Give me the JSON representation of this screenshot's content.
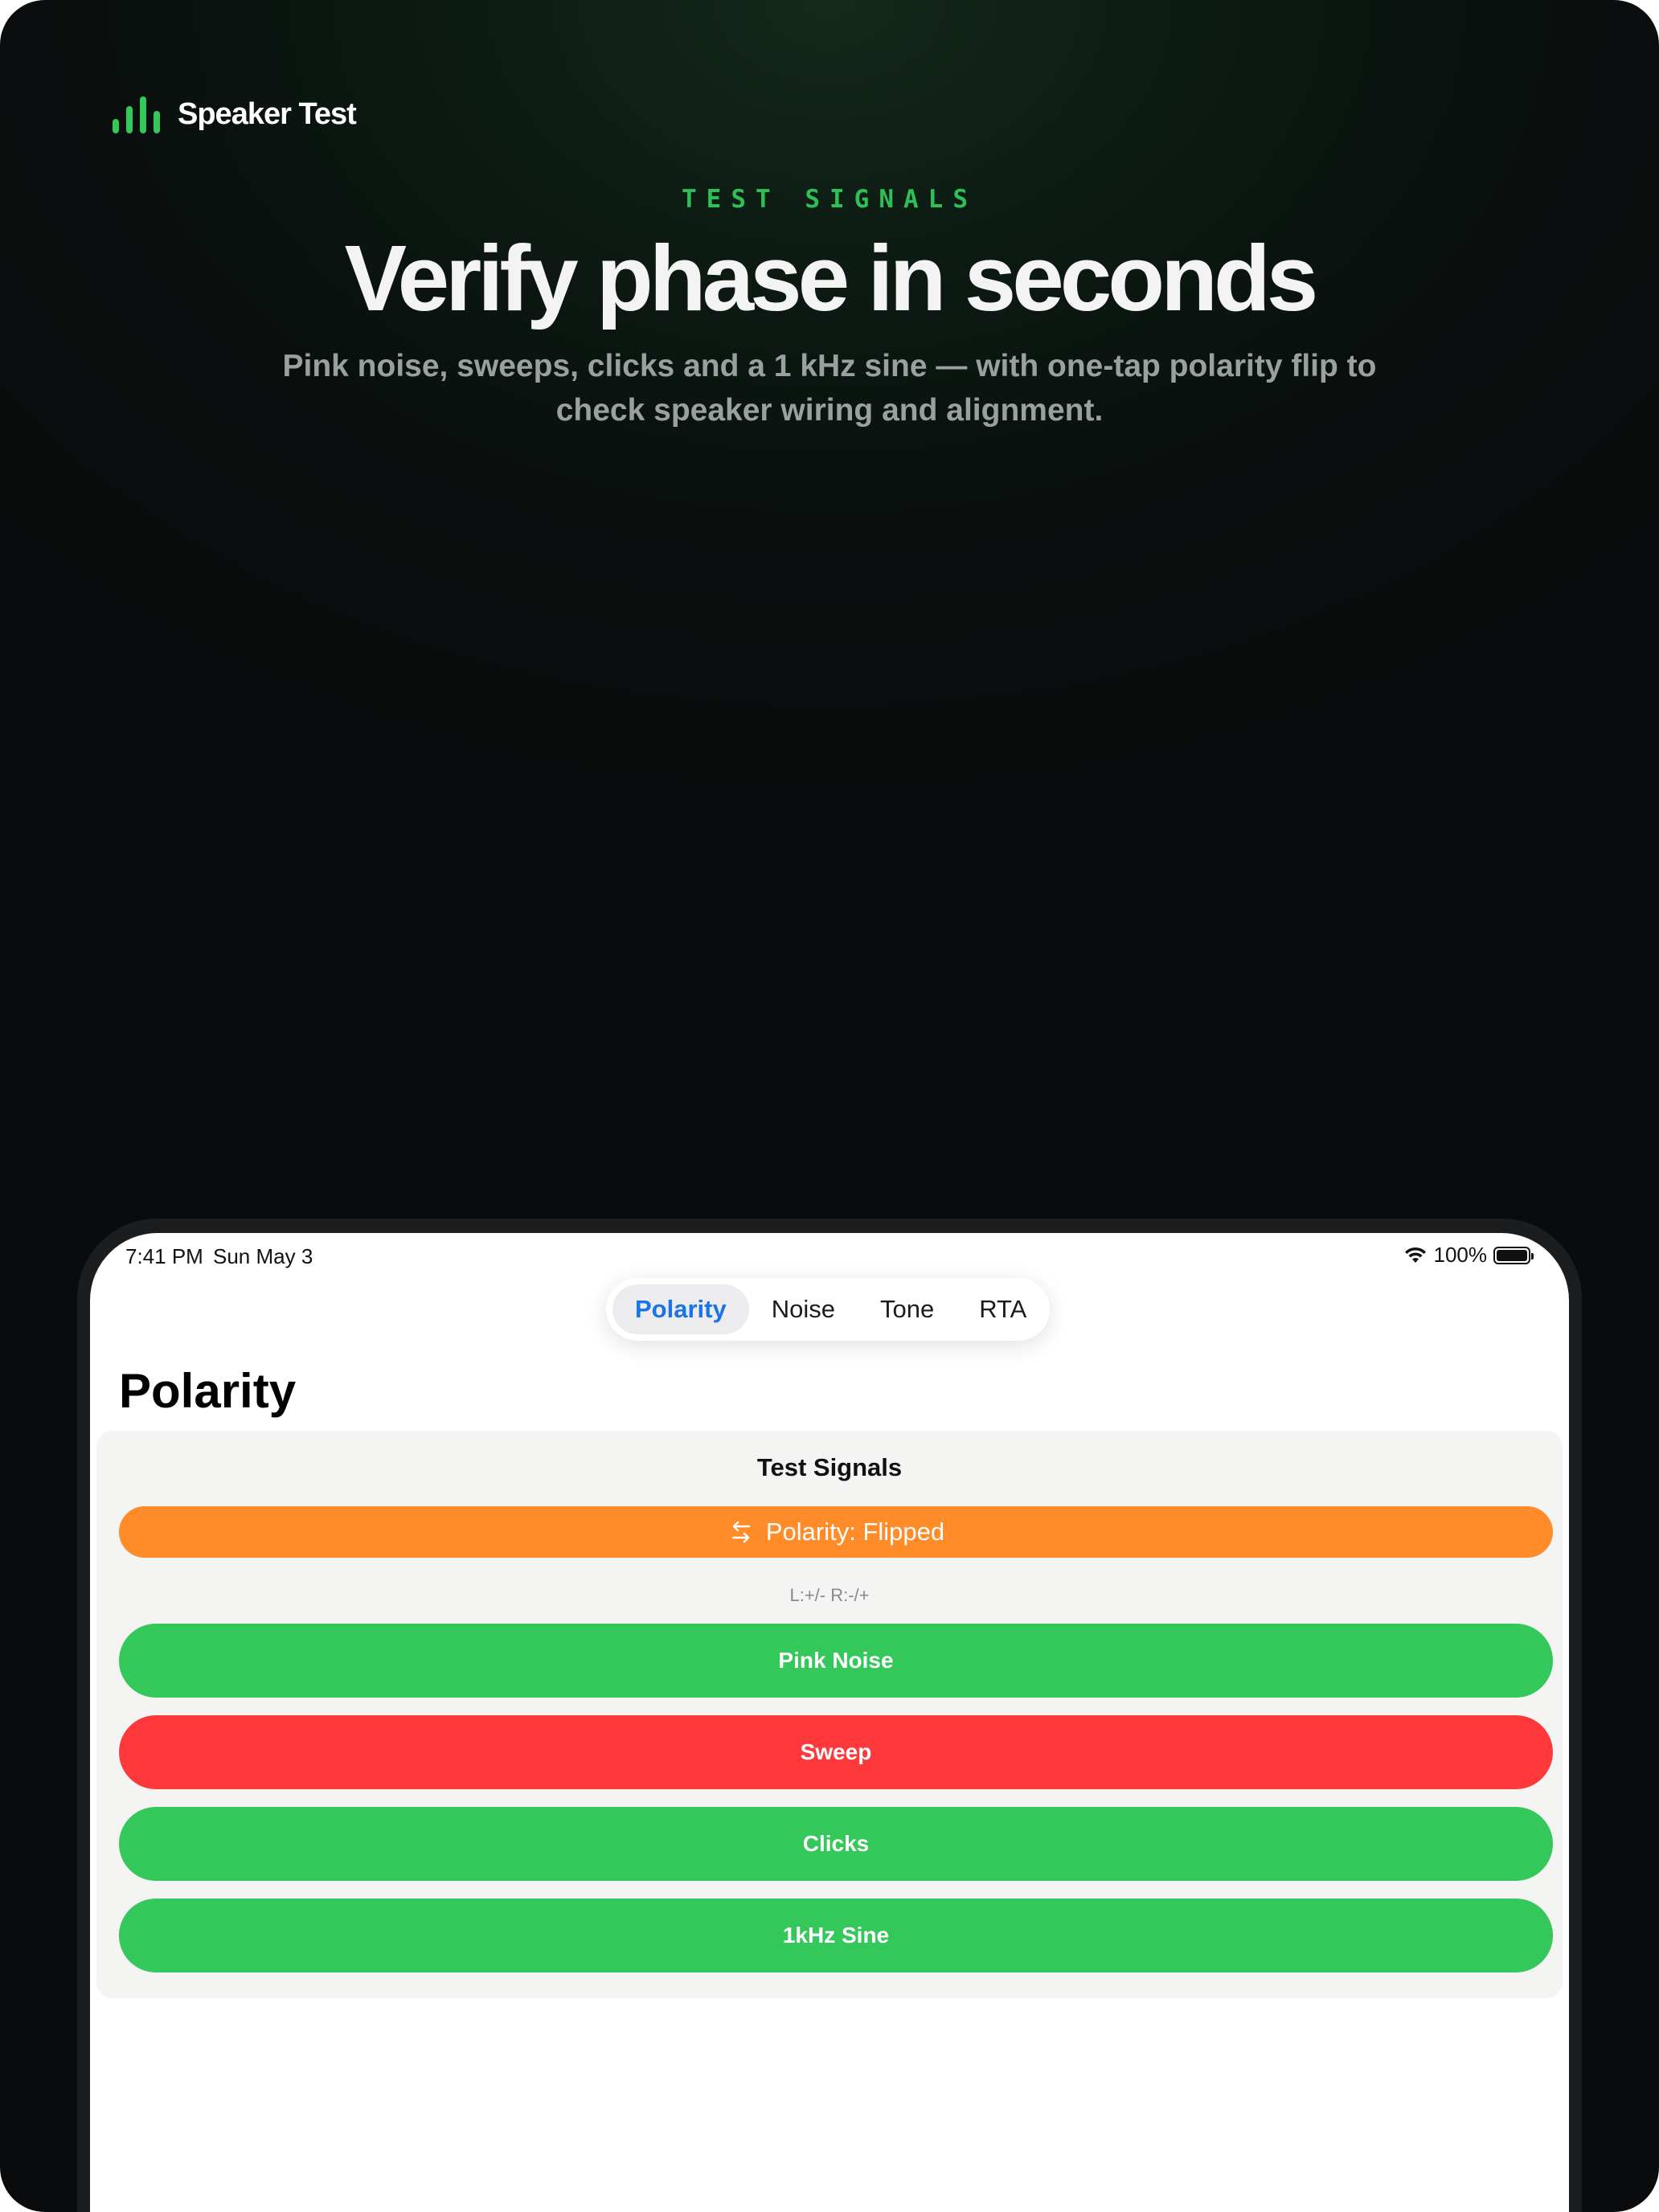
{
  "brand": {
    "name": "Speaker Test",
    "icon": "audio-bars-icon",
    "accent": "#32c85a"
  },
  "hero": {
    "eyebrow": "TEST SIGNALS",
    "headline": "Verify phase in seconds",
    "subhead": "Pink noise, sweeps, clicks and a 1 kHz sine — with one-tap polarity flip to check speaker wiring and alignment."
  },
  "status_bar": {
    "time": "7:41 PM",
    "date": "Sun May 3",
    "battery": "100%",
    "wifi_icon": "wifi-icon",
    "battery_icon": "battery-icon"
  },
  "tabs": [
    {
      "label": "Polarity",
      "active": true
    },
    {
      "label": "Noise",
      "active": false
    },
    {
      "label": "Tone",
      "active": false
    },
    {
      "label": "RTA",
      "active": false
    }
  ],
  "page": {
    "title": "Polarity",
    "panel_title": "Test Signals",
    "polarity_button": {
      "label": "Polarity: Flipped",
      "icon": "swap-arrows-icon",
      "color": "#ff8c29"
    },
    "channels": "L:+/- R:-/+",
    "signals": [
      {
        "label": "Pink Noise",
        "state": "idle",
        "color": "#34c85a"
      },
      {
        "label": "Sweep",
        "state": "playing",
        "color": "#ff383c"
      },
      {
        "label": "Clicks",
        "state": "idle",
        "color": "#34c85a"
      },
      {
        "label": "1kHz Sine",
        "state": "idle",
        "color": "#34c85a"
      }
    ]
  }
}
